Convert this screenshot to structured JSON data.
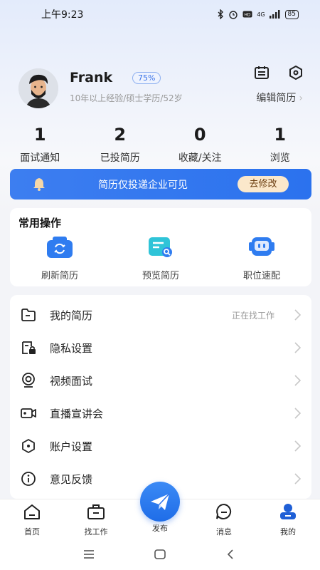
{
  "status_bar": {
    "time": "上午9:23",
    "battery": "85",
    "signal_label": "4G"
  },
  "profile": {
    "name": "Frank",
    "completion": "75%",
    "info": "10年以上经验/硕士学历/52岁",
    "edit_label": "编辑简历"
  },
  "stats": [
    {
      "value": "1",
      "label": "面试通知"
    },
    {
      "value": "2",
      "label": "已投简历"
    },
    {
      "value": "0",
      "label": "收藏/关注"
    },
    {
      "value": "1",
      "label": "浏览"
    }
  ],
  "banner": {
    "text": "简历仅投递企业可见",
    "button": "去修改"
  },
  "common_ops": {
    "title": "常用操作",
    "items": [
      {
        "label": "刷新简历",
        "icon": "refresh-resume-icon"
      },
      {
        "label": "预览简历",
        "icon": "preview-resume-icon"
      },
      {
        "label": "职位速配",
        "icon": "job-match-robot-icon"
      }
    ]
  },
  "menu": [
    {
      "label": "我的简历",
      "value": "正在找工作",
      "icon": "folder-icon"
    },
    {
      "label": "隐私设置",
      "value": "",
      "icon": "privacy-lock-icon"
    },
    {
      "label": "视频面试",
      "value": "",
      "icon": "webcam-icon"
    },
    {
      "label": "直播宣讲会",
      "value": "",
      "icon": "video-camera-icon"
    },
    {
      "label": "账户设置",
      "value": "",
      "icon": "hexagon-settings-icon"
    },
    {
      "label": "意见反馈",
      "value": "",
      "icon": "info-icon"
    }
  ],
  "tabs": [
    {
      "label": "首页",
      "icon": "home-icon"
    },
    {
      "label": "找工作",
      "icon": "briefcase-icon"
    },
    {
      "label": "发布",
      "icon": "paper-plane-icon"
    },
    {
      "label": "消息",
      "icon": "message-icon"
    },
    {
      "label": "我的",
      "icon": "profile-icon"
    }
  ],
  "colors": {
    "accent": "#2b72ee",
    "active_tab": "#1f5fd6",
    "banner_button_bg": "#fbe8cb"
  }
}
